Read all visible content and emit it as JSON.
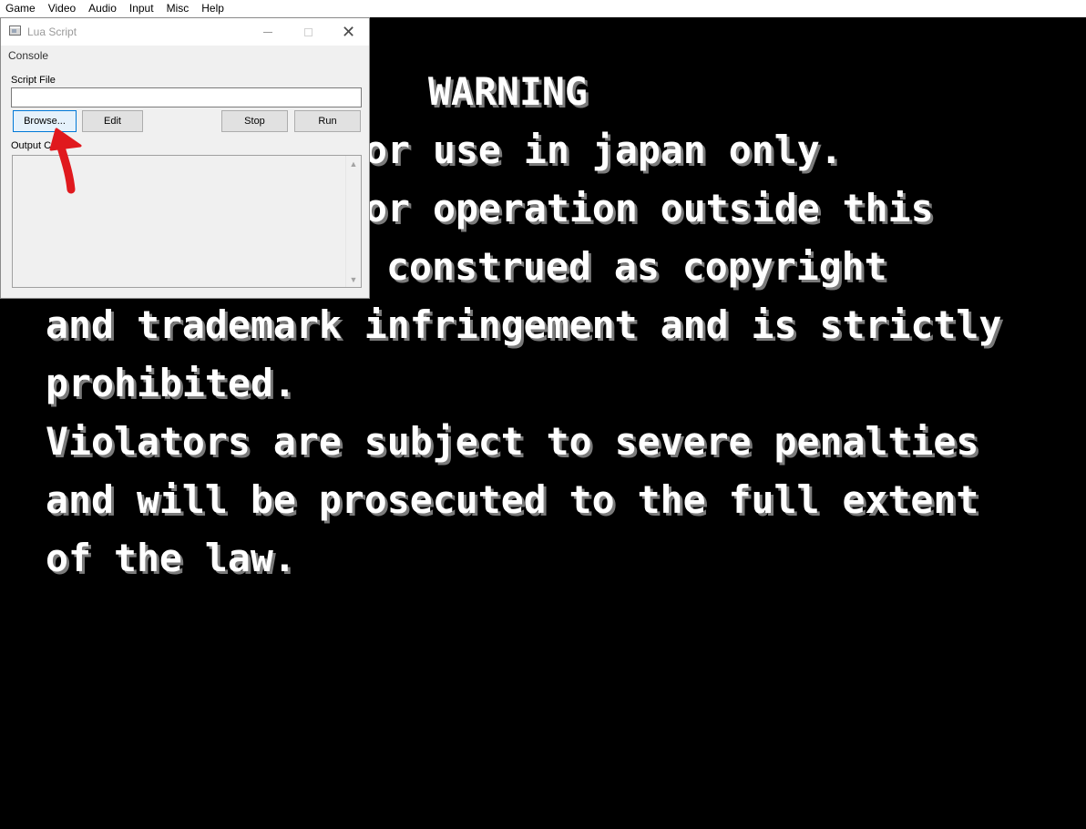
{
  "menubar": {
    "items": [
      {
        "label": "Game"
      },
      {
        "label": "Video"
      },
      {
        "label": "Audio"
      },
      {
        "label": "Input"
      },
      {
        "label": "Misc"
      },
      {
        "label": "Help"
      }
    ]
  },
  "game_screen": {
    "lines": [
      "WARNING",
      "or use in japan only.",
      "or operation outside this",
      "construed as copyright",
      "and trademark infringement and is strictly",
      "prohibited.",
      "Violators are subject to severe penalties",
      "and will be prosecuted to the full extent",
      "of the law."
    ]
  },
  "lua_window": {
    "title": "Lua Script",
    "console_menu": "Console",
    "script_file_label": "Script File",
    "script_file_value": "",
    "buttons": {
      "browse": "Browse...",
      "edit": "Edit",
      "stop": "Stop",
      "run": "Run"
    },
    "output_label": "Output C",
    "output_text": ""
  },
  "colors": {
    "annotation_arrow": "#e0191e",
    "game_text": "#ffffff",
    "game_text_shadow": "#7a7a7a"
  },
  "icons": [
    "minimize-icon",
    "maximize-icon",
    "close-icon",
    "app-icon",
    "scroll-up-icon",
    "scroll-down-icon",
    "annotation-arrow"
  ]
}
